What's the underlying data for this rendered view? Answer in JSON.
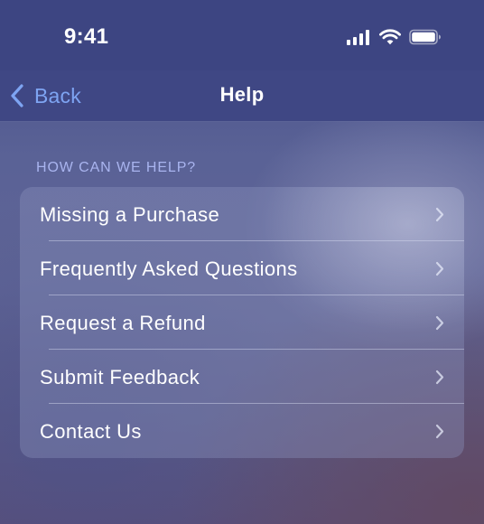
{
  "status_bar": {
    "time": "9:41",
    "icons": [
      "cellular-signal-icon",
      "wifi-icon",
      "battery-icon"
    ]
  },
  "nav": {
    "back_label": "Back",
    "title": "Help"
  },
  "section": {
    "header": "HOW CAN WE HELP?"
  },
  "menu": {
    "items": [
      {
        "label": "Missing a Purchase",
        "icon": "chevron-right-icon"
      },
      {
        "label": "Frequently Asked Questions",
        "icon": "chevron-right-icon"
      },
      {
        "label": "Request a Refund",
        "icon": "chevron-right-icon"
      },
      {
        "label": "Submit Feedback",
        "icon": "chevron-right-icon"
      },
      {
        "label": "Contact Us",
        "icon": "chevron-right-icon"
      }
    ]
  },
  "colors": {
    "accent": "#7ea4f2",
    "section_header": "#a9b4ef",
    "nav_background": "#3f4784"
  }
}
